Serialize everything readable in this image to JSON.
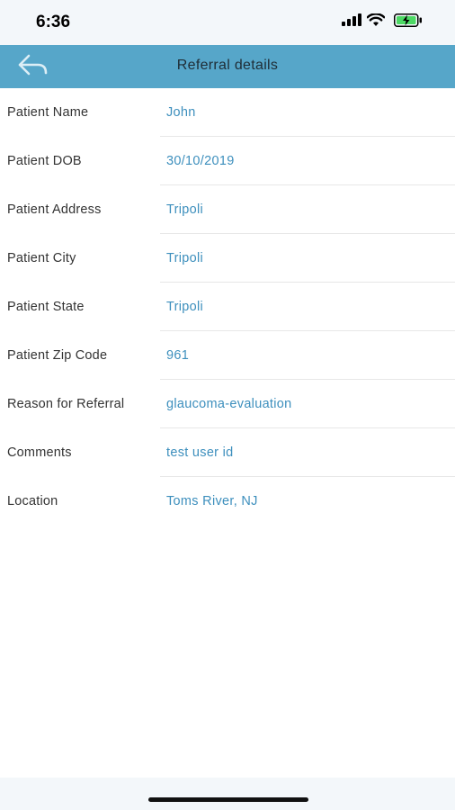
{
  "status_bar": {
    "time": "6:36",
    "icons": [
      "cellular-signal-icon",
      "wifi-icon",
      "battery-charging-icon"
    ]
  },
  "navbar": {
    "title": "Referral details",
    "back_icon": "back-arrow-icon",
    "bg_color": "#56a6c9"
  },
  "details": [
    {
      "label": "Patient Name",
      "value": "John"
    },
    {
      "label": "Patient DOB",
      "value": "30/10/2019"
    },
    {
      "label": "Patient Address",
      "value": "Tripoli"
    },
    {
      "label": "Patient City",
      "value": "Tripoli"
    },
    {
      "label": "Patient State",
      "value": "Tripoli"
    },
    {
      "label": "Patient Zip Code",
      "value": "961"
    },
    {
      "label": "Reason for Referral",
      "value": "glaucoma-evaluation"
    },
    {
      "label": "Comments",
      "value": "test user id"
    },
    {
      "label": "Location",
      "value": "Toms River, NJ"
    }
  ],
  "colors": {
    "value_text": "#3d8fbd",
    "label_text": "#333333"
  }
}
